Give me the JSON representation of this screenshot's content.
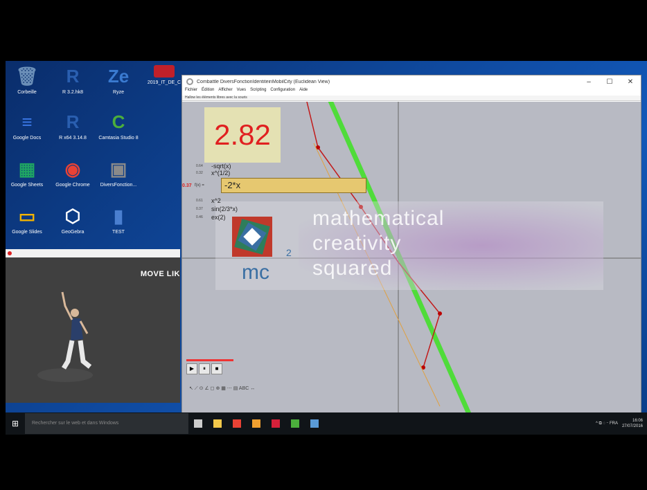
{
  "desktop": {
    "icons": [
      {
        "label": "Corbeille",
        "glyph": "🗑",
        "color": "#6b8fb8"
      },
      {
        "label": "R 3.2.hk8",
        "glyph": "R",
        "color": "#2a5fb0"
      },
      {
        "label": "Ryze",
        "glyph": "Ze",
        "color": "#3a7ad0"
      },
      {
        "label": "2019_IT_DE_C",
        "glyph": "",
        "color": "#c0202a"
      },
      {
        "label": "Google Docs",
        "glyph": "≡",
        "color": "#3b78e7"
      },
      {
        "label": "R x64 3.14.8",
        "glyph": "R",
        "color": "#2a5fb0"
      },
      {
        "label": "Camtasia Studio 8",
        "glyph": "C",
        "color": "#4bae3c"
      },
      {
        "label": "Google Sheets",
        "glyph": "▦",
        "color": "#1fa463"
      },
      {
        "label": "Google Chrome",
        "glyph": "◉",
        "color": "#e94235"
      },
      {
        "label": "DiversFonction...",
        "glyph": "▣",
        "color": "#8a8a8a"
      },
      {
        "label": "Google Slides",
        "glyph": "▭",
        "color": "#f4b400"
      },
      {
        "label": "GeoGebra",
        "glyph": "⬡",
        "color": "#ffffff"
      },
      {
        "label": "TEST",
        "glyph": "▮",
        "color": "#4a7fd0"
      }
    ]
  },
  "video": {
    "window_title": "",
    "overlay_text": "MOVE LIK"
  },
  "app": {
    "title": "Combattle DiversFonctionIdentiteinMobilCity (Euclidean View)",
    "menu": [
      "Fichier",
      "Édition",
      "Afficher",
      "Vues",
      "Scripting",
      "Configuration",
      "Aide"
    ],
    "hint": "Hallow les éléments libres avec la souris",
    "min_label": "–",
    "max_label": "☐",
    "close_label": "✕",
    "big_number": "2.82",
    "functions": [
      {
        "num": "0.64",
        "expr": "-sqrt(x)"
      },
      {
        "num": "0.32",
        "expr": "x^(1/2)"
      },
      {
        "num": "0.61",
        "expr": "x^2"
      },
      {
        "num": "0.37",
        "expr": "sin(2/3*x)"
      },
      {
        "num": "0.46",
        "expr": "ex(2)"
      }
    ],
    "active": {
      "value": "0.37",
      "label": "f(x) =",
      "expr": "-2*x"
    },
    "banner": {
      "mc": "mc",
      "sup": "2",
      "line1": "mathematical",
      "line2": "creativity",
      "line3": "squared"
    },
    "playbar": [
      "▶",
      "⏸",
      "■"
    ],
    "toolbar_text": "↖  ⟋  ⊙  ∠  ◻  ⊕  ▦  ⋯  ▤  ABC  ↔"
  },
  "taskbar": {
    "start_glyph": "⊞",
    "search_placeholder": "Rechercher sur le web et dans Windows",
    "apps": [
      {
        "name": "task-view",
        "color": "#cccccc"
      },
      {
        "name": "file-explorer",
        "color": "#f2c84b"
      },
      {
        "name": "chrome",
        "color": "#e94235"
      },
      {
        "name": "paint",
        "color": "#f0a030"
      },
      {
        "name": "record",
        "color": "#d6203a"
      },
      {
        "name": "camtasia",
        "color": "#4bae3c"
      },
      {
        "name": "app-c",
        "color": "#5a9bd8"
      }
    ],
    "tray_text": "^  ⧉  ◌  ⌁  FRA",
    "time": "16:06",
    "date": "27/07/2016"
  }
}
